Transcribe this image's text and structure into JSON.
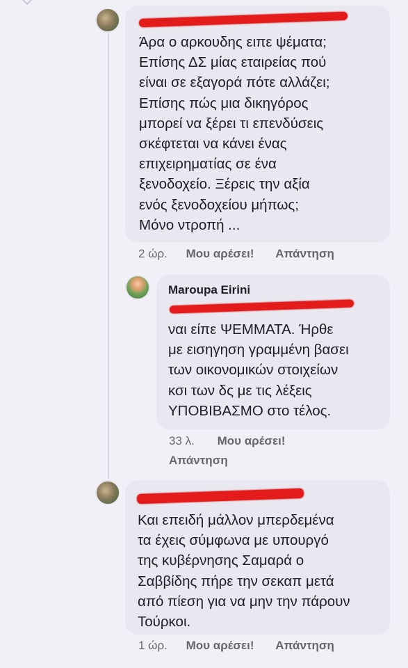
{
  "comments": [
    {
      "name": "",
      "lines": [
        "Άρα ο αρκουδης ειπε ψέματα;",
        "Επίσης ΔΣ μίας εταιρείας πού",
        "είναι σε εξαγορά πότε αλλάζει;",
        "Επίσης πώς μια δικηγόρος",
        "μπορεί να ξέρει τι επενδύσεις",
        "σκέφτεται να κάνει ένας",
        "επιχειρηματίας σε ένα",
        "ξενοδοχείο. Ξέρεις την αξία",
        "ενός ξενοδοχείου μήπως;",
        "Μόνο ντροπή ..."
      ],
      "time": "2 ώρ.",
      "like": "Μου αρέσει!",
      "reply": "Απάντηση"
    },
    {
      "name": "Maroupa Eirini",
      "lines": [
        "ναι είπε ΨΕΜΜΑΤΑ. Ήρθε",
        "με εισηγηση γραμμένη βασει",
        "των οικονομικών στοιχείων",
        "κσι των δς με τις λέξεις",
        "ΥΠΟΒΙΒΑΣΜΟ στο τέλος."
      ],
      "time": "33 λ.",
      "like": "Μου αρέσει!",
      "reply": "Απάντηση"
    },
    {
      "name": "",
      "lines": [
        "Και επειδή μάλλον μπερδεμένα",
        "τα έχεις σύμφωνα με υπουργό",
        "της κυβέρνησης Σαμαρά ο",
        "Σαββίδης πήρε την σεκαπ μετά",
        "από πίεση για να μην την πάρουν",
        "Τούρκοι."
      ],
      "time": "1 ώρ.",
      "like": "Μου αρέσει!",
      "reply": "Απάντηση"
    }
  ]
}
